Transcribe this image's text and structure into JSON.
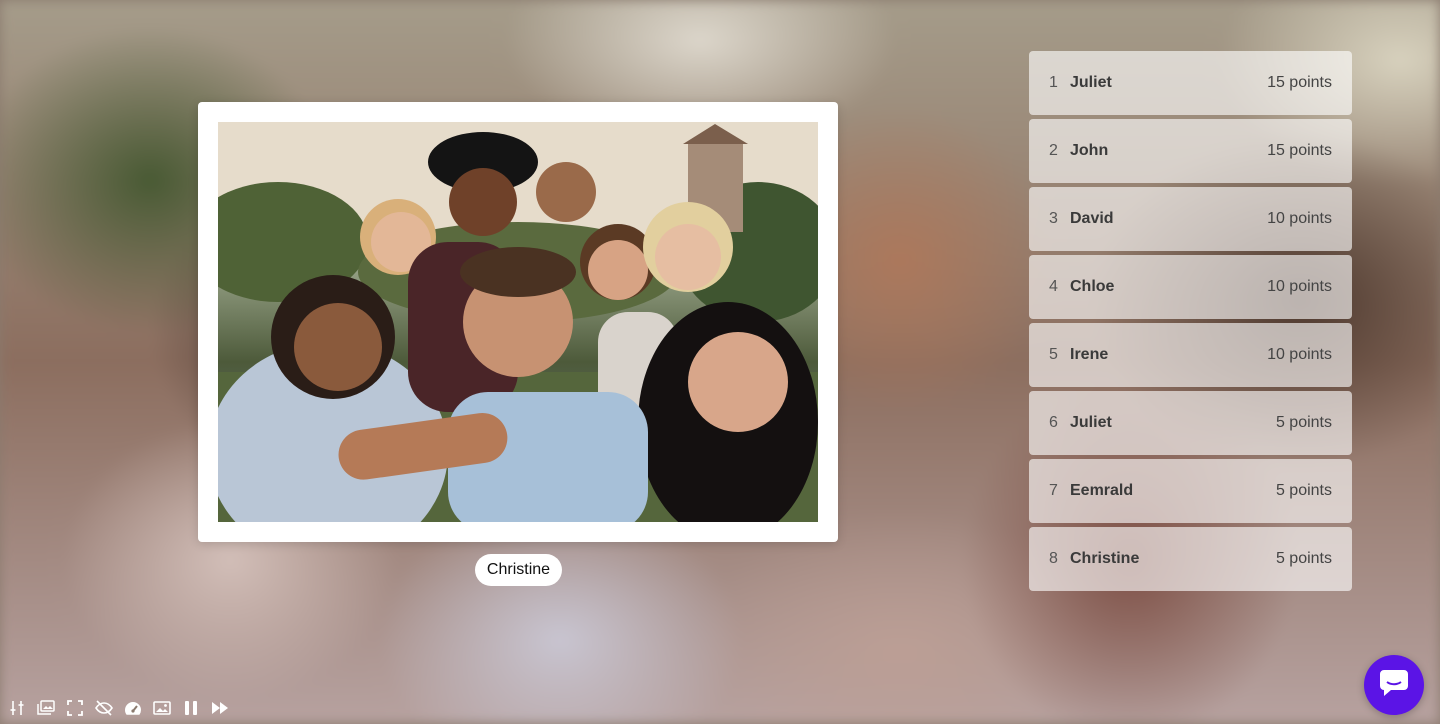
{
  "photo": {
    "caption": "Christine"
  },
  "leaderboard": [
    {
      "rank": "1",
      "name": "Juliet",
      "points": "15 points"
    },
    {
      "rank": "2",
      "name": "John",
      "points": "15 points"
    },
    {
      "rank": "3",
      "name": "David",
      "points": "10 points"
    },
    {
      "rank": "4",
      "name": "Chloe",
      "points": "10 points"
    },
    {
      "rank": "5",
      "name": "Irene",
      "points": "10 points"
    },
    {
      "rank": "6",
      "name": "Juliet",
      "points": "5 points"
    },
    {
      "rank": "7",
      "name": "Eemrald",
      "points": "5 points"
    },
    {
      "rank": "8",
      "name": "Christine",
      "points": "5 points"
    }
  ],
  "toolbar": {
    "icons": [
      "settings-sliders-icon",
      "gallery-icon",
      "fullscreen-icon",
      "hide-icon",
      "speed-icon",
      "image-icon",
      "pause-icon",
      "fast-forward-icon"
    ]
  },
  "chat": {
    "icon": "chat-bubble-icon"
  },
  "colors": {
    "accent": "#5b14e6",
    "card_bg": "#ffffff"
  }
}
